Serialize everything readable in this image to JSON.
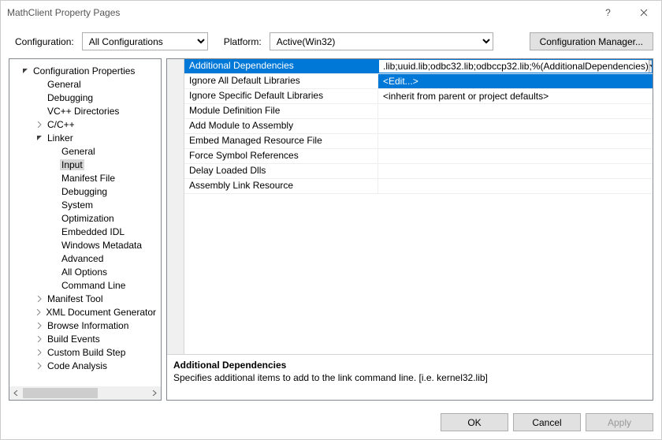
{
  "window": {
    "title": "MathClient Property Pages"
  },
  "topbar": {
    "config_label": "Configuration:",
    "config_value": "All Configurations",
    "platform_label": "Platform:",
    "platform_value": "Active(Win32)",
    "config_mgr": "Configuration Manager..."
  },
  "tree": {
    "root": "Configuration Properties",
    "items1": [
      "General",
      "Debugging",
      "VC++ Directories"
    ],
    "ccpp": "C/C++",
    "linker": "Linker",
    "linker_items": [
      "General",
      "Input",
      "Manifest File",
      "Debugging",
      "System",
      "Optimization",
      "Embedded IDL",
      "Windows Metadata",
      "Advanced",
      "All Options",
      "Command Line"
    ],
    "rest": [
      "Manifest Tool",
      "XML Document Generator",
      "Browse Information",
      "Build Events",
      "Custom Build Step",
      "Code Analysis"
    ]
  },
  "grid": {
    "rows": [
      {
        "label": "Additional Dependencies",
        "value": ".lib;uuid.lib;odbc32.lib;odbccp32.lib;%(AdditionalDependencies)",
        "selected": true,
        "dropdown": true
      },
      {
        "label": "Ignore All Default Libraries",
        "value": "<Edit...>",
        "option": true
      },
      {
        "label": "Ignore Specific Default Libraries",
        "value": "<inherit from parent or project defaults>"
      },
      {
        "label": "Module Definition File",
        "value": ""
      },
      {
        "label": "Add Module to Assembly",
        "value": ""
      },
      {
        "label": "Embed Managed Resource File",
        "value": ""
      },
      {
        "label": "Force Symbol References",
        "value": ""
      },
      {
        "label": "Delay Loaded Dlls",
        "value": ""
      },
      {
        "label": "Assembly Link Resource",
        "value": ""
      }
    ]
  },
  "desc": {
    "title": "Additional Dependencies",
    "text": "Specifies additional items to add to the link command line. [i.e. kernel32.lib]"
  },
  "footer": {
    "ok": "OK",
    "cancel": "Cancel",
    "apply": "Apply"
  }
}
